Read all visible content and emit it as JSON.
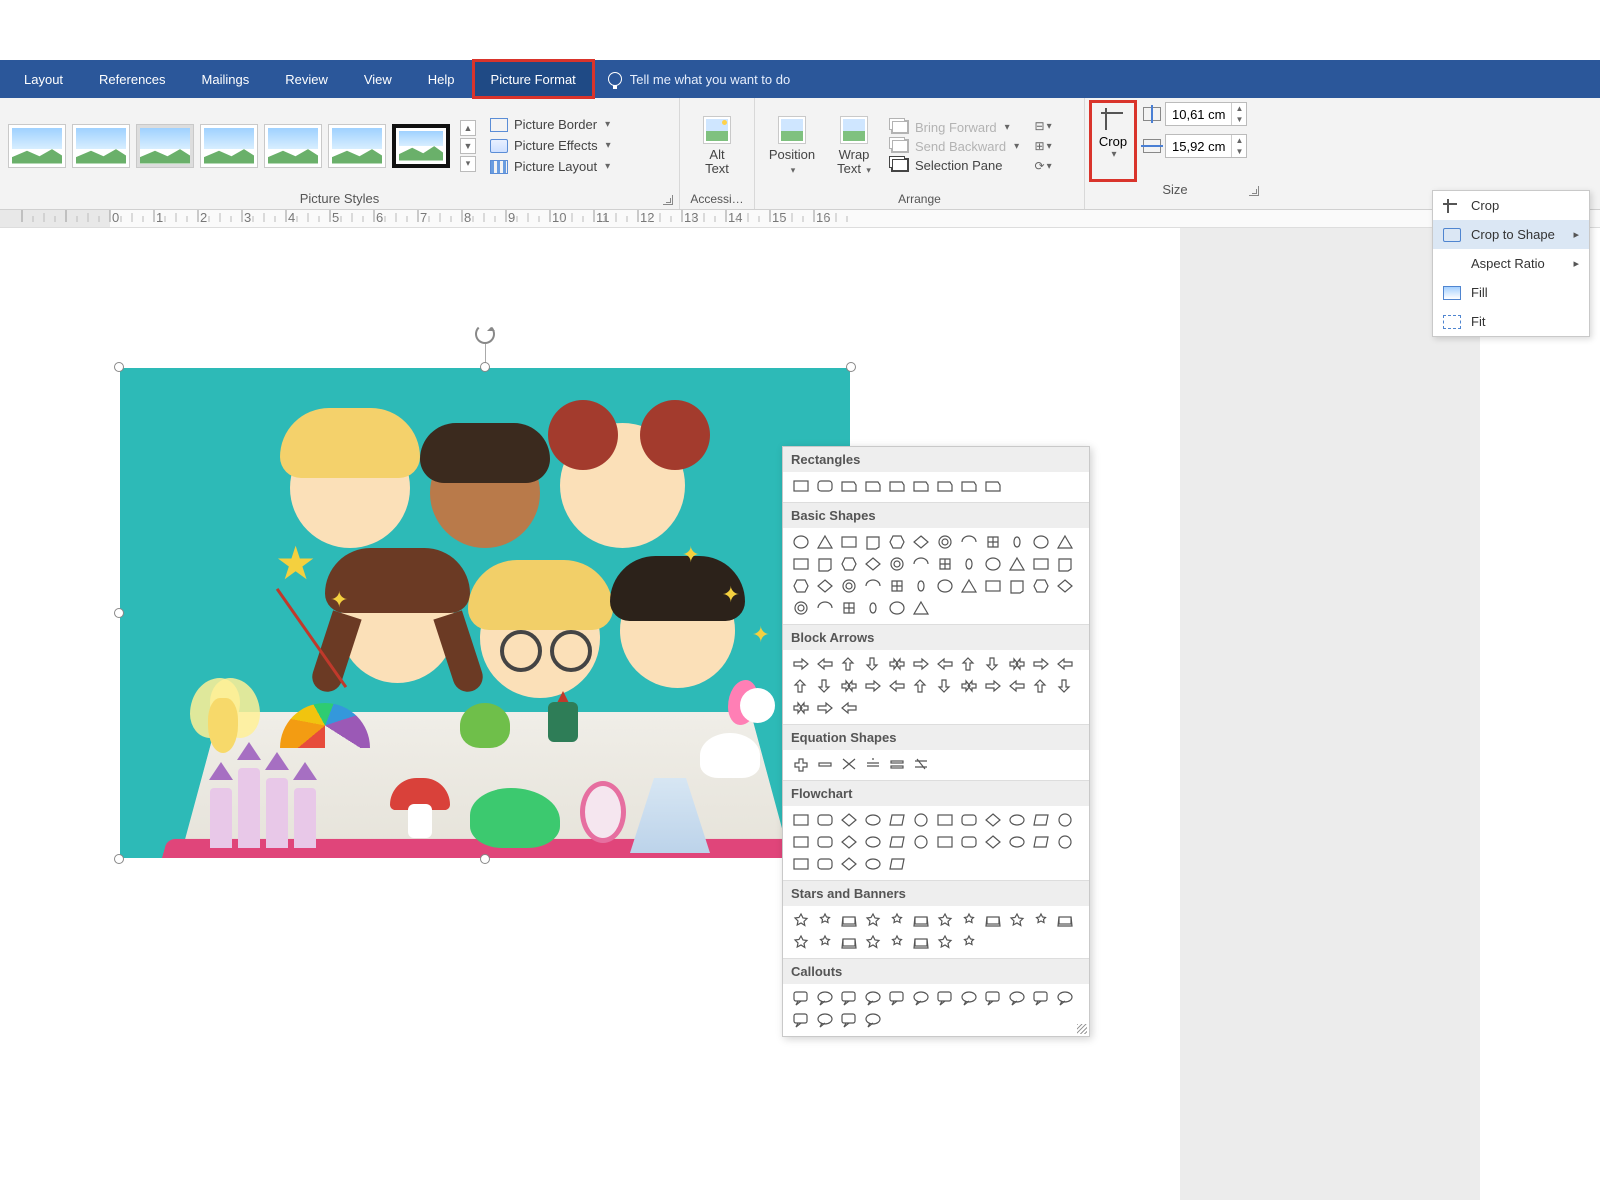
{
  "ribbon_tabs": {
    "layout": "Layout",
    "references": "References",
    "mailings": "Mailings",
    "review": "Review",
    "view": "View",
    "help": "Help",
    "picture_format": "Picture Format",
    "tell_me": "Tell me what you want to do"
  },
  "groups": {
    "picture_styles": "Picture Styles",
    "accessibility": "Accessi…",
    "arrange": "Arrange",
    "size": "Size"
  },
  "picture_options": {
    "border": "Picture Border",
    "effects": "Picture Effects",
    "layout": "Picture Layout"
  },
  "buttons": {
    "alt_text_1": "Alt",
    "alt_text_2": "Text",
    "position": "Position",
    "wrap_1": "Wrap",
    "wrap_2": "Text",
    "crop": "Crop"
  },
  "arrange": {
    "bring_forward": "Bring Forward",
    "send_backward": "Send Backward",
    "selection_pane": "Selection Pane"
  },
  "size": {
    "height": "10,61 cm",
    "width": "15,92 cm"
  },
  "crop_menu": {
    "crop": "Crop",
    "crop_to_shape": "Crop to Shape",
    "aspect_ratio": "Aspect Ratio",
    "fill": "Fill",
    "fit": "Fit"
  },
  "shape_categories": {
    "rectangles": "Rectangles",
    "basic_shapes": "Basic Shapes",
    "block_arrows": "Block Arrows",
    "equation_shapes": "Equation Shapes",
    "flowchart": "Flowchart",
    "stars_banners": "Stars and Banners",
    "callouts": "Callouts"
  }
}
